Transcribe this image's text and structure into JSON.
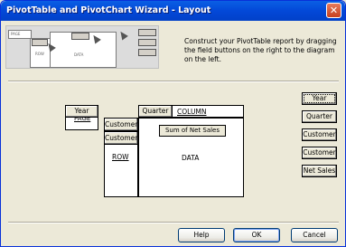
{
  "window": {
    "title": "PivotTable and PivotChart Wizard - Layout",
    "close": "✕"
  },
  "thumbnail": {
    "page_label": "PAGE",
    "row_label": "ROW",
    "data_label": "DATA",
    "column_label": "COLUMN"
  },
  "instructions": "Construct your PivotTable report by dragging the field buttons on the right to the diagram on the left.",
  "layout": {
    "page_field": "Year",
    "page_label": "PAGE",
    "column_field": "Quarter",
    "column_label": "COLUMN",
    "row_fields": [
      "Customer",
      "Customer"
    ],
    "row_label": "ROW",
    "data_field": "Sum of Net Sales",
    "data_label": "DATA"
  },
  "fields": [
    "Year",
    "Quarter",
    "Customer",
    "Customer",
    "Net Sales"
  ],
  "buttons": {
    "help": "Help",
    "ok": "OK",
    "cancel": "Cancel"
  }
}
